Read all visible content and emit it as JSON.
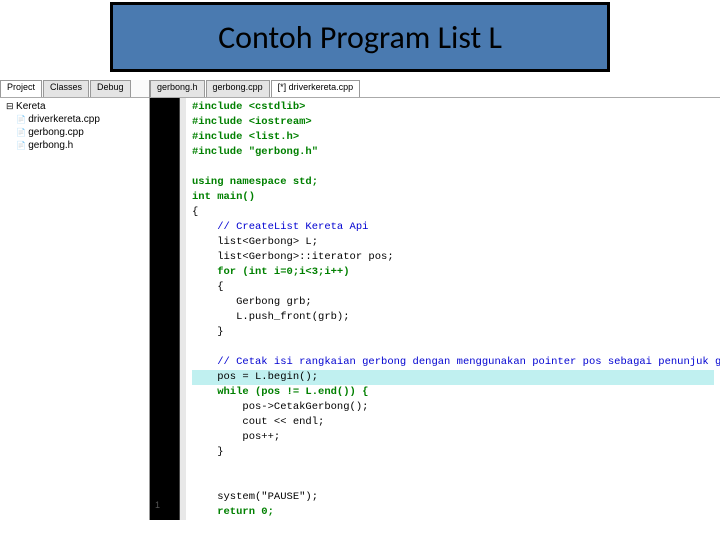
{
  "title": "Contoh Program List L",
  "sidebar_tabs": [
    "Project",
    "Classes",
    "Debug"
  ],
  "editor_tabs": [
    "gerbong.h",
    "gerbong.cpp",
    "[*] driverkereta.cpp"
  ],
  "active_editor_tab": 2,
  "tree": {
    "root": "Kereta",
    "children": [
      "driverkereta.cpp",
      "gerbong.cpp",
      "gerbong.h"
    ]
  },
  "code_lines": [
    {
      "t": "#include <cstdlib>",
      "cls": "kw"
    },
    {
      "t": "#include <iostream>",
      "cls": "kw"
    },
    {
      "t": "#include <list.h>",
      "cls": "kw"
    },
    {
      "t": "#include \"gerbong.h\"",
      "cls": "kw"
    },
    {
      "t": "",
      "cls": ""
    },
    {
      "t": "using namespace std;",
      "cls": "kw"
    },
    {
      "t": "int main()",
      "cls": "kw"
    },
    {
      "t": "{",
      "cls": ""
    },
    {
      "t": "    // CreateList Kereta Api",
      "cls": "cmt"
    },
    {
      "t": "    list<Gerbong> L;",
      "cls": ""
    },
    {
      "t": "    list<Gerbong>::iterator pos;",
      "cls": ""
    },
    {
      "t": "    for (int i=0;i<3;i++)",
      "cls": "kw"
    },
    {
      "t": "    {",
      "cls": ""
    },
    {
      "t": "       Gerbong grb;",
      "cls": ""
    },
    {
      "t": "       L.push_front(grb);",
      "cls": ""
    },
    {
      "t": "    }",
      "cls": ""
    },
    {
      "t": "",
      "cls": ""
    },
    {
      "t": "    // Cetak isi rangkaian gerbong dengan menggunakan pointer pos sebagai penunjuk gerbong",
      "cls": "cmt"
    },
    {
      "t": "    pos = L.begin();",
      "cls": "",
      "hl": true
    },
    {
      "t": "    while (pos != L.end()) {",
      "cls": "kw"
    },
    {
      "t": "        pos->CetakGerbong();",
      "cls": ""
    },
    {
      "t": "        cout << endl;",
      "cls": ""
    },
    {
      "t": "        pos++;",
      "cls": ""
    },
    {
      "t": "    }",
      "cls": ""
    },
    {
      "t": "",
      "cls": ""
    },
    {
      "t": "",
      "cls": ""
    },
    {
      "t": "    system(\"PAUSE\");",
      "cls": ""
    },
    {
      "t": "    return 0;",
      "cls": "kw"
    },
    {
      "t": "}",
      "cls": ""
    }
  ],
  "status": "1"
}
